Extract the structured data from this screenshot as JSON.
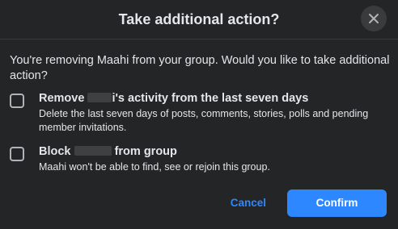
{
  "dialog": {
    "title": "Take additional action?",
    "close_icon": "close-icon",
    "intro": "You're removing Maahi from your group. Would you like to take additional action?",
    "options": [
      {
        "title_prefix": "Remove",
        "title_suffix": "i's activity from the last seven days",
        "description": "Delete the last seven days of posts, comments, stories, polls and pending member invitations.",
        "checked": false
      },
      {
        "title_prefix": "Block",
        "title_suffix": "from group",
        "description": "Maahi won't be able to find, see or rejoin this group.",
        "checked": false
      }
    ],
    "cancel_label": "Cancel",
    "confirm_label": "Confirm"
  },
  "colors": {
    "background": "#242526",
    "text": "#e4e6eb",
    "accent": "#2d88ff",
    "close_bg": "#3a3b3c",
    "checkbox_border": "#b0b3b8"
  }
}
